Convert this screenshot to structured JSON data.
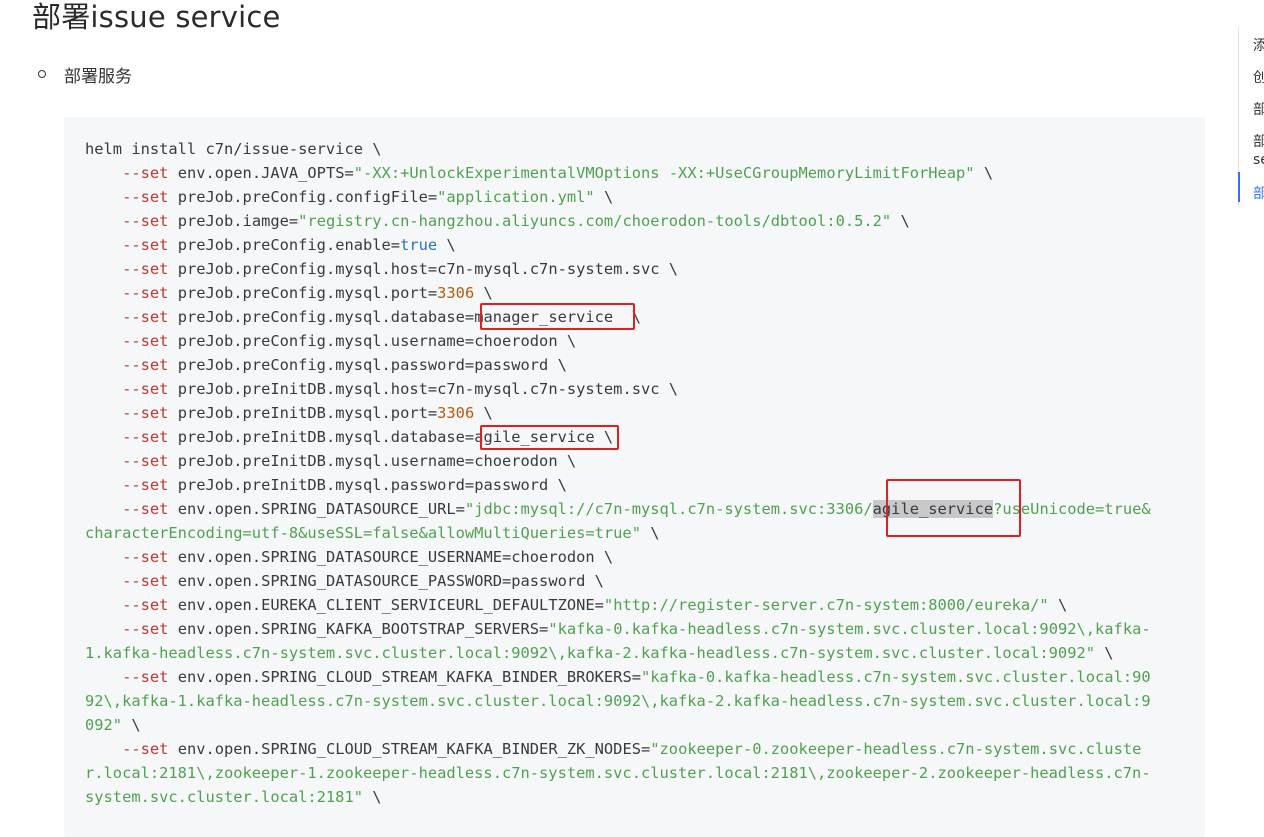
{
  "page": {
    "title": "部署issue service",
    "bullet": "部署服务"
  },
  "code": {
    "lines": [
      [
        {
          "t": "helm install c7n/issue-service \\"
        }
      ],
      [
        {
          "t": "    "
        },
        {
          "t": "--set",
          "c": "kw"
        },
        {
          "t": " env.open.JAVA_OPTS="
        },
        {
          "t": "\"-XX:+UnlockExperimentalVMOptions -XX:+UseCGroupMemoryLimitForHeap\"",
          "c": "str"
        },
        {
          "t": " \\"
        }
      ],
      [
        {
          "t": "    "
        },
        {
          "t": "--set",
          "c": "kw"
        },
        {
          "t": " preJob.preConfig.configFile="
        },
        {
          "t": "\"application.yml\"",
          "c": "str"
        },
        {
          "t": " \\"
        }
      ],
      [
        {
          "t": "    "
        },
        {
          "t": "--set",
          "c": "kw"
        },
        {
          "t": " preJob.iamge="
        },
        {
          "t": "\"registry.cn-hangzhou.aliyuncs.com/choerodon-tools/dbtool:0.5.2\"",
          "c": "str"
        },
        {
          "t": " \\"
        }
      ],
      [
        {
          "t": "    "
        },
        {
          "t": "--set",
          "c": "kw"
        },
        {
          "t": " preJob.preConfig.enable="
        },
        {
          "t": "true",
          "c": "bool"
        },
        {
          "t": " \\"
        }
      ],
      [
        {
          "t": "    "
        },
        {
          "t": "--set",
          "c": "kw"
        },
        {
          "t": " preJob.preConfig.mysql.host=c7n-mysql.c7n-system.svc \\"
        }
      ],
      [
        {
          "t": "    "
        },
        {
          "t": "--set",
          "c": "kw"
        },
        {
          "t": " preJob.preConfig.mysql.port="
        },
        {
          "t": "3306",
          "c": "num"
        },
        {
          "t": " \\"
        }
      ],
      [
        {
          "t": "    "
        },
        {
          "t": "--set",
          "c": "kw"
        },
        {
          "t": " preJob.preConfig.mysql.database=manager_service  \\"
        }
      ],
      [
        {
          "t": "    "
        },
        {
          "t": "--set",
          "c": "kw"
        },
        {
          "t": " preJob.preConfig.mysql.username=choerodon \\"
        }
      ],
      [
        {
          "t": "    "
        },
        {
          "t": "--set",
          "c": "kw"
        },
        {
          "t": " preJob.preConfig.mysql.password=password \\"
        }
      ],
      [
        {
          "t": "    "
        },
        {
          "t": "--set",
          "c": "kw"
        },
        {
          "t": " preJob.preInitDB.mysql.host=c7n-mysql.c7n-system.svc \\"
        }
      ],
      [
        {
          "t": "    "
        },
        {
          "t": "--set",
          "c": "kw"
        },
        {
          "t": " preJob.preInitDB.mysql.port="
        },
        {
          "t": "3306",
          "c": "num"
        },
        {
          "t": " \\"
        }
      ],
      [
        {
          "t": "    "
        },
        {
          "t": "--set",
          "c": "kw"
        },
        {
          "t": " preJob.preInitDB.mysql.database=agile_service \\"
        }
      ],
      [
        {
          "t": "    "
        },
        {
          "t": "--set",
          "c": "kw"
        },
        {
          "t": " preJob.preInitDB.mysql.username=choerodon \\"
        }
      ],
      [
        {
          "t": "    "
        },
        {
          "t": "--set",
          "c": "kw"
        },
        {
          "t": " preJob.preInitDB.mysql.password=password \\"
        }
      ],
      [
        {
          "t": "    "
        },
        {
          "t": "--set",
          "c": "kw"
        },
        {
          "t": " env.open.SPRING_DATASOURCE_URL="
        },
        {
          "t": "\"jdbc:mysql://c7n-mysql.c7n-system.svc:3306/",
          "c": "str"
        },
        {
          "t": "agile_service",
          "c": "hl"
        },
        {
          "t": "?useUnicode=true&",
          "c": "str"
        }
      ],
      [
        {
          "t": "characterEncoding=utf-8&useSSL=false&allowMultiQueries=true\"",
          "c": "str"
        },
        {
          "t": " \\"
        }
      ],
      [
        {
          "t": "    "
        },
        {
          "t": "--set",
          "c": "kw"
        },
        {
          "t": " env.open.SPRING_DATASOURCE_USERNAME=choerodon \\"
        }
      ],
      [
        {
          "t": "    "
        },
        {
          "t": "--set",
          "c": "kw"
        },
        {
          "t": " env.open.SPRING_DATASOURCE_PASSWORD=password \\"
        }
      ],
      [
        {
          "t": "    "
        },
        {
          "t": "--set",
          "c": "kw"
        },
        {
          "t": " env.open.EUREKA_CLIENT_SERVICEURL_DEFAULTZONE="
        },
        {
          "t": "\"http://register-server.c7n-system:8000/eureka/\"",
          "c": "str"
        },
        {
          "t": " \\"
        }
      ],
      [
        {
          "t": "    "
        },
        {
          "t": "--set",
          "c": "kw"
        },
        {
          "t": " env.open.SPRING_KAFKA_BOOTSTRAP_SERVERS="
        },
        {
          "t": "\"kafka-0.kafka-headless.c7n-system.svc.cluster.local:9092\\,kafka-",
          "c": "str"
        }
      ],
      [
        {
          "t": "1.kafka-headless.c7n-system.svc.cluster.local:9092\\,kafka-2.kafka-headless.c7n-system.svc.cluster.local:9092\"",
          "c": "str"
        },
        {
          "t": " \\"
        }
      ],
      [
        {
          "t": "    "
        },
        {
          "t": "--set",
          "c": "kw"
        },
        {
          "t": " env.open.SPRING_CLOUD_STREAM_KAFKA_BINDER_BROKERS="
        },
        {
          "t": "\"kafka-0.kafka-headless.c7n-system.svc.cluster.local:90",
          "c": "str"
        }
      ],
      [
        {
          "t": "92\\,kafka-1.kafka-headless.c7n-system.svc.cluster.local:9092\\,kafka-2.kafka-headless.c7n-system.svc.cluster.local:9",
          "c": "str"
        }
      ],
      [
        {
          "t": "092\"",
          "c": "str"
        },
        {
          "t": " \\"
        }
      ],
      [
        {
          "t": "    "
        },
        {
          "t": "--set",
          "c": "kw"
        },
        {
          "t": " env.open.SPRING_CLOUD_STREAM_KAFKA_BINDER_ZK_NODES="
        },
        {
          "t": "\"zookeeper-0.zookeeper-headless.c7n-system.svc.cluste",
          "c": "str"
        }
      ],
      [
        {
          "t": "r.local:2181\\,zookeeper-1.zookeeper-headless.c7n-system.svc.cluster.local:2181\\,zookeeper-2.zookeeper-headless.c7n-",
          "c": "str"
        }
      ],
      [
        {
          "t": "system.svc.cluster.local:2181\"",
          "c": "str"
        },
        {
          "t": " \\"
        }
      ]
    ]
  },
  "toc": {
    "items": [
      {
        "label": "添"
      },
      {
        "label": "创"
      },
      {
        "label": "部"
      },
      {
        "label": "部"
      },
      {
        "label": "se"
      },
      {
        "label": "部"
      }
    ]
  }
}
